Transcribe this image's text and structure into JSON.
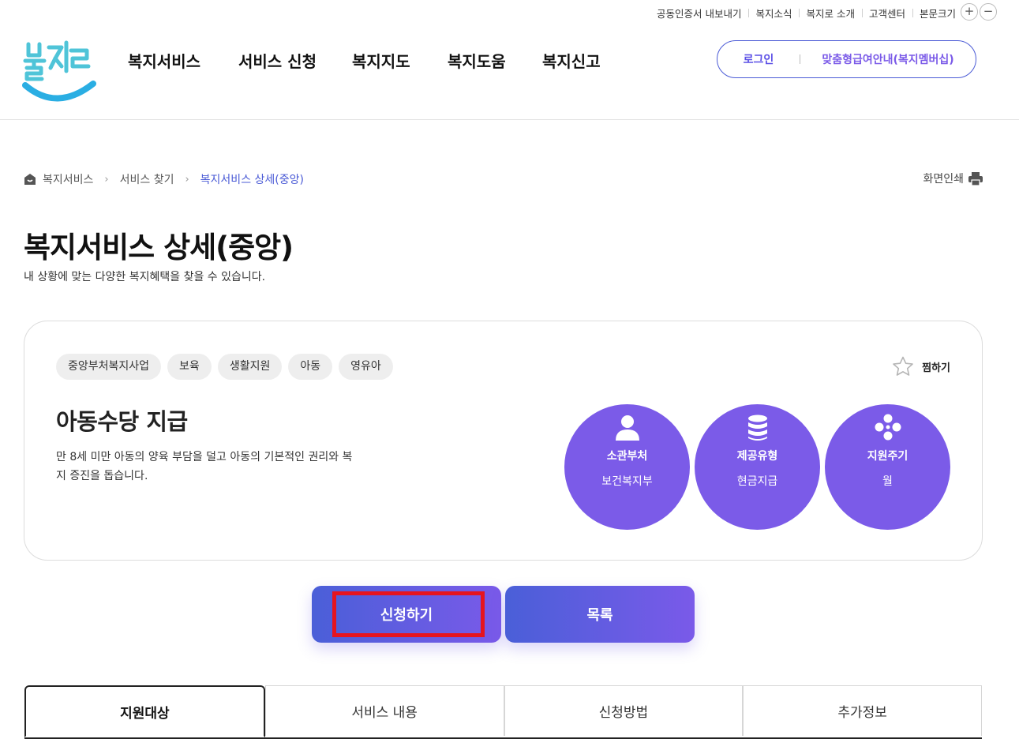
{
  "util": {
    "links": [
      "공동인증서 내보내기",
      "복지소식",
      "복지로 소개",
      "고객센터"
    ],
    "font_size_label": "본문크기",
    "plus": "+",
    "minus": "−"
  },
  "logo": {
    "text": "복지로"
  },
  "gnb": [
    "복지서비스",
    "서비스 신청",
    "복지지도",
    "복지도움",
    "복지신고"
  ],
  "member": {
    "login": "로그인",
    "membership": "맞춤형급여안내(복지멤버십)"
  },
  "breadcrumb": [
    "복지서비스",
    "서비스 찾기",
    "복지서비스 상세(중앙)"
  ],
  "print_label": "화면인쇄",
  "page": {
    "title": "복지서비스 상세(중앙)",
    "description": "내 상황에 맞는 다양한 복지혜택을 찾을 수 있습니다."
  },
  "card": {
    "tags": [
      "중앙부처복지사업",
      "보육",
      "생활지원",
      "아동",
      "영유아"
    ],
    "favorite_label": "찜하기",
    "title": "아동수당 지급",
    "description": "만 8세 미만 아동의 양육 부담을 덜고 아동의 기본적인 권리와 복지 증진을 돕습니다.",
    "info": [
      {
        "label": "소관부처",
        "value": "보건복지부",
        "icon": "person-icon"
      },
      {
        "label": "제공유형",
        "value": "현금지급",
        "icon": "coins-icon"
      },
      {
        "label": "지원주기",
        "value": "월",
        "icon": "cycle-icon"
      }
    ]
  },
  "buttons": {
    "apply": "신청하기",
    "list": "목록"
  },
  "tabs": [
    "지원대상",
    "서비스 내용",
    "신청방법",
    "추가정보"
  ],
  "colors": {
    "accent": "#7b5be8",
    "primary": "#4b5bd6",
    "highlight": "#e6141f"
  }
}
